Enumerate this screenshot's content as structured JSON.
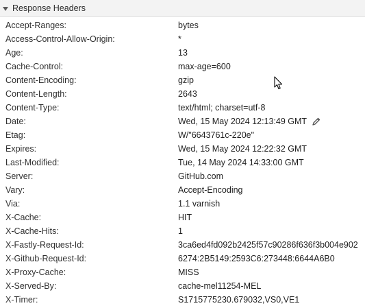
{
  "section": {
    "title": "Response Headers",
    "collapse_icon": "triangle-down-icon"
  },
  "headers": [
    {
      "name": "Accept-Ranges:",
      "value": "bytes"
    },
    {
      "name": "Access-Control-Allow-Origin:",
      "value": "*"
    },
    {
      "name": "Age:",
      "value": "13"
    },
    {
      "name": "Cache-Control:",
      "value": "max-age=600"
    },
    {
      "name": "Content-Encoding:",
      "value": "gzip"
    },
    {
      "name": "Content-Length:",
      "value": "2643"
    },
    {
      "name": "Content-Type:",
      "value": "text/html; charset=utf-8"
    },
    {
      "name": "Date:",
      "value": "Wed, 15 May 2024 12:13:49 GMT"
    },
    {
      "name": "Etag:",
      "value": "W/\"6643761c-220e\""
    },
    {
      "name": "Expires:",
      "value": "Wed, 15 May 2024 12:22:32 GMT"
    },
    {
      "name": "Last-Modified:",
      "value": "Tue, 14 May 2024 14:33:00 GMT"
    },
    {
      "name": "Server:",
      "value": "GitHub.com"
    },
    {
      "name": "Vary:",
      "value": "Accept-Encoding"
    },
    {
      "name": "Via:",
      "value": "1.1 varnish"
    },
    {
      "name": "X-Cache:",
      "value": "HIT"
    },
    {
      "name": "X-Cache-Hits:",
      "value": "1"
    },
    {
      "name": "X-Fastly-Request-Id:",
      "value": "3ca6ed4fd092b2425f57c90286f636f3b004e902"
    },
    {
      "name": "X-Github-Request-Id:",
      "value": "6274:2B5149:2593C6:273448:6644A6B0"
    },
    {
      "name": "X-Proxy-Cache:",
      "value": "MISS"
    },
    {
      "name": "X-Served-By:",
      "value": "cache-mel11254-MEL"
    },
    {
      "name": "X-Timer:",
      "value": "S1715775230.679032,VS0,VE1"
    }
  ],
  "icons": {
    "edit": "pencil-icon",
    "pointer": "mouse-cursor-icon"
  }
}
